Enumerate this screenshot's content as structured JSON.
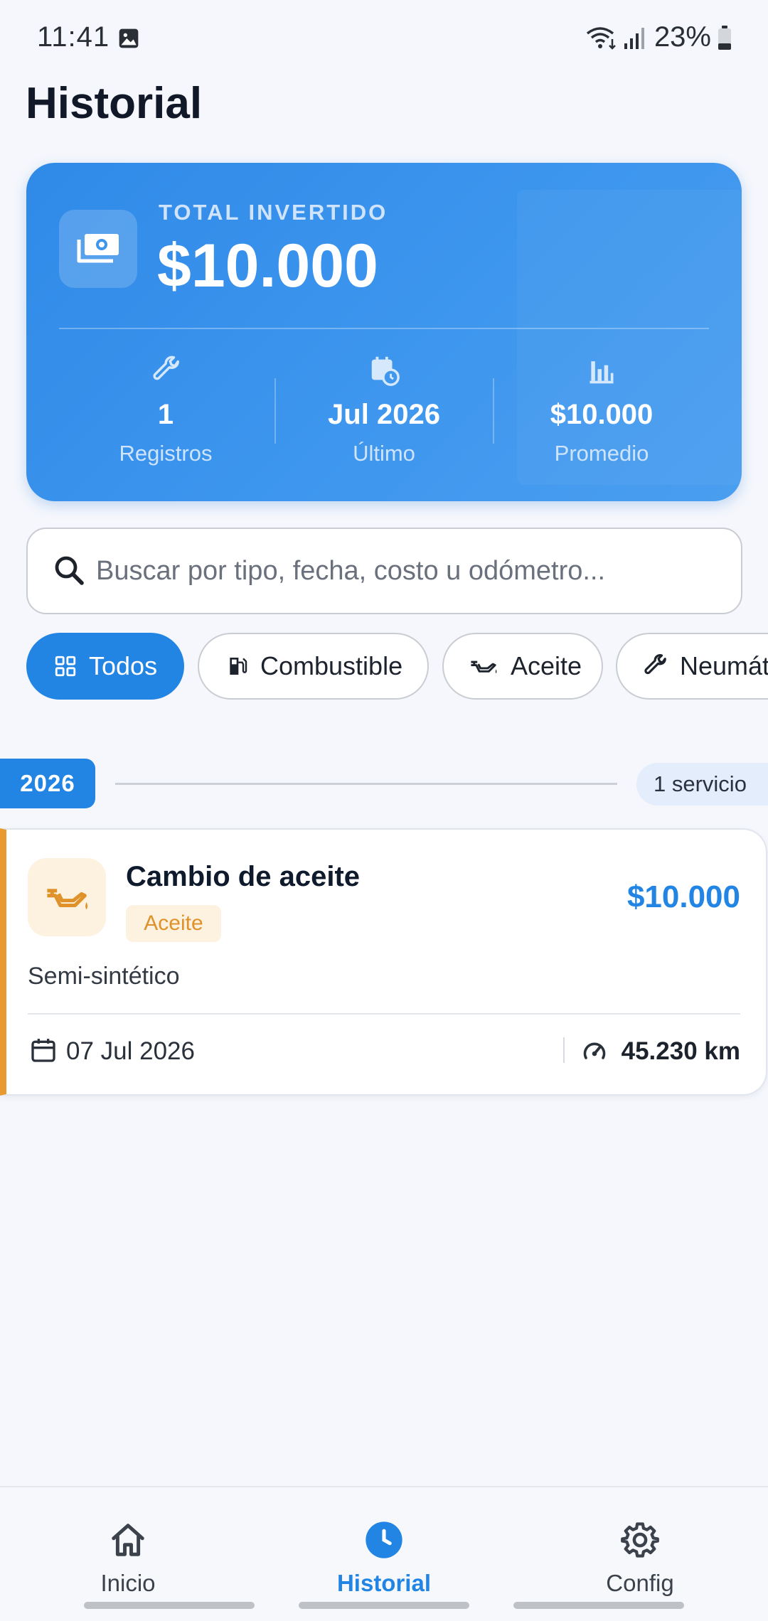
{
  "status_bar": {
    "time": "11:41",
    "battery_percent": "23%",
    "icons": [
      "gallery-icon",
      "wifi-icon",
      "signal-icon",
      "battery-icon"
    ]
  },
  "page": {
    "title": "Historial"
  },
  "summary": {
    "label": "TOTAL INVERTIDO",
    "amount": "$10.000",
    "icon": "money-icon",
    "stats": [
      {
        "icon": "wrench-icon",
        "value": "1",
        "label": "Registros"
      },
      {
        "icon": "calendar-clock-icon",
        "value": "Jul 2026",
        "label": "Último"
      },
      {
        "icon": "bar-chart-icon",
        "value": "$10.000",
        "label": "Promedio"
      }
    ]
  },
  "search": {
    "placeholder": "Buscar por tipo, fecha, costo u odómetro...",
    "value": ""
  },
  "filters": [
    {
      "label": "Todos",
      "icon": "grid-icon",
      "selected": true
    },
    {
      "label": "Combustible",
      "icon": "fuel-pump-icon",
      "selected": false
    },
    {
      "label": "Aceite",
      "icon": "oil-can-icon",
      "selected": false
    },
    {
      "label": "Neumát",
      "icon": "wrench-icon",
      "selected": false
    }
  ],
  "groups": [
    {
      "year": "2026",
      "count_label": "1 servicio",
      "records": [
        {
          "title": "Cambio de aceite",
          "tag": "Aceite",
          "amount": "$10.000",
          "description": "Semi-sintético",
          "date": "07 Jul 2026",
          "odometer": "45.230 km",
          "accent_color": "#E89A2E"
        }
      ]
    }
  ],
  "bottom_nav": [
    {
      "label": "Inicio",
      "icon": "home-icon",
      "active": false
    },
    {
      "label": "Historial",
      "icon": "clock-icon",
      "active": true
    },
    {
      "label": "Config",
      "icon": "gear-icon",
      "active": false
    }
  ],
  "colors": {
    "primary": "#2285E4",
    "oil_accent": "#E89A2E",
    "background": "#F5F7FC",
    "card_gradient_start": "#2F8AE8",
    "card_gradient_end": "#4A9EF0"
  }
}
